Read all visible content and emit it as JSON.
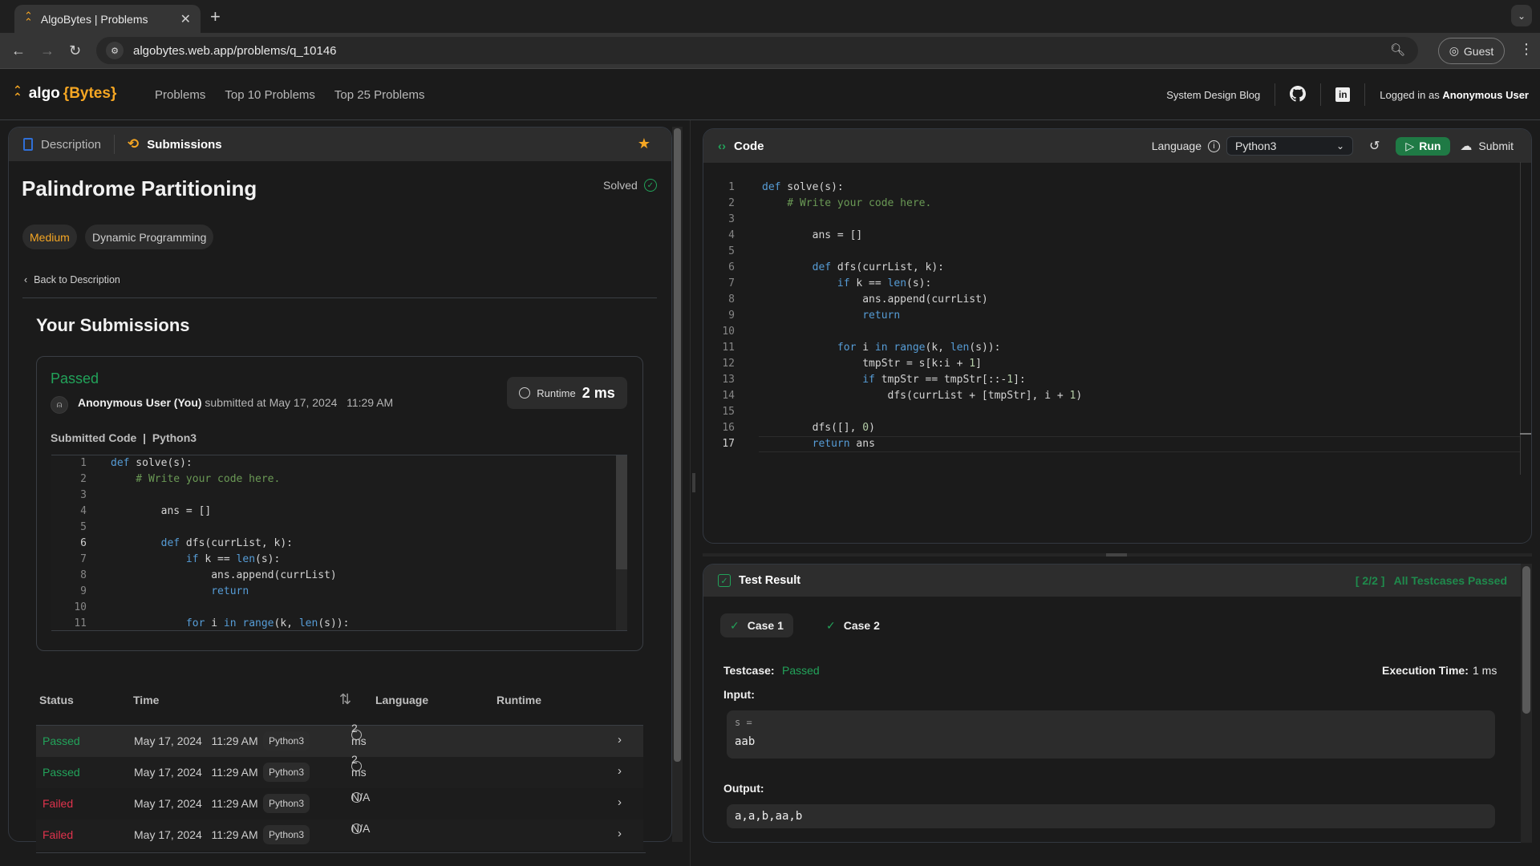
{
  "browser": {
    "tab_title": "AlgoBytes | Problems",
    "url": "algobytes.web.app/problems/q_10146",
    "profile_label": "Guest"
  },
  "header": {
    "logo_main": "algo",
    "logo_accent": "{Bytes}",
    "nav": [
      "Problems",
      "Top 10 Problems",
      "Top 25 Problems"
    ],
    "blog_link": "System Design Blog",
    "logged_in_prefix": "Logged in as",
    "user_name": "Anonymous User"
  },
  "left_panel": {
    "tabs": [
      {
        "label": "Description",
        "active": false
      },
      {
        "label": "Submissions",
        "active": true
      }
    ],
    "problem_title": "Palindrome Partitioning",
    "solved_label": "Solved",
    "difficulty": "Medium",
    "topic": "Dynamic Programming",
    "back_link": "Back to Description",
    "submissions_heading": "Your Submissions",
    "latest": {
      "status": "Passed",
      "user": "Anonymous User (You)",
      "submitted_text": "submitted at May 17, 2024   11:29 AM",
      "runtime_label": "Runtime",
      "runtime_value": "2 ms",
      "code_label": "Submitted Code",
      "code_language": "Python3",
      "cursor_line": 6
    },
    "table": {
      "headers": [
        "Status",
        "Time",
        "Language",
        "Runtime"
      ],
      "rows": [
        {
          "status": "Passed",
          "time": "May 17, 2024   11:29 AM",
          "language": "Python3",
          "runtime": "2 ms"
        },
        {
          "status": "Passed",
          "time": "May 17, 2024   11:29 AM",
          "language": "Python3",
          "runtime": "2 ms"
        },
        {
          "status": "Failed",
          "time": "May 17, 2024   11:29 AM",
          "language": "Python3",
          "runtime": "N/A"
        },
        {
          "status": "Failed",
          "time": "May 17, 2024   11:29 AM",
          "language": "Python3",
          "runtime": "N/A"
        }
      ]
    }
  },
  "code_panel": {
    "title": "Code",
    "language_label": "Language",
    "language_value": "Python3",
    "run_label": "Run",
    "submit_label": "Submit",
    "current_line": 17,
    "lines": [
      "def solve(s):",
      "    # Write your code here.",
      "",
      "        ans = []",
      "",
      "        def dfs(currList, k):",
      "            if k == len(s):",
      "                ans.append(currList)",
      "                return",
      "",
      "            for i in range(k, len(s)):",
      "                tmpStr = s[k:i + 1]",
      "                if tmpStr == tmpStr[::-1]:",
      "                    dfs(currList + [tmpStr], i + 1)",
      "",
      "        dfs([], 0)",
      "        return ans"
    ]
  },
  "test_result": {
    "title": "Test Result",
    "summary_count": "[ 2/2 ]",
    "summary_text": "All Testcases Passed",
    "cases": [
      {
        "label": "Case 1",
        "active": true
      },
      {
        "label": "Case 2",
        "active": false
      }
    ],
    "testcase_label": "Testcase:",
    "testcase_status": "Passed",
    "exec_label": "Execution Time:",
    "exec_value": "1 ms",
    "input_label": "Input:",
    "input_var": "s =",
    "input_value": "aab",
    "output_label": "Output:",
    "output_value": "a,a,b,aa,b"
  },
  "colors": {
    "accent": "#f5a623",
    "success": "#22a35a",
    "failure": "#e0334d",
    "run_button": "#1f7a45"
  }
}
